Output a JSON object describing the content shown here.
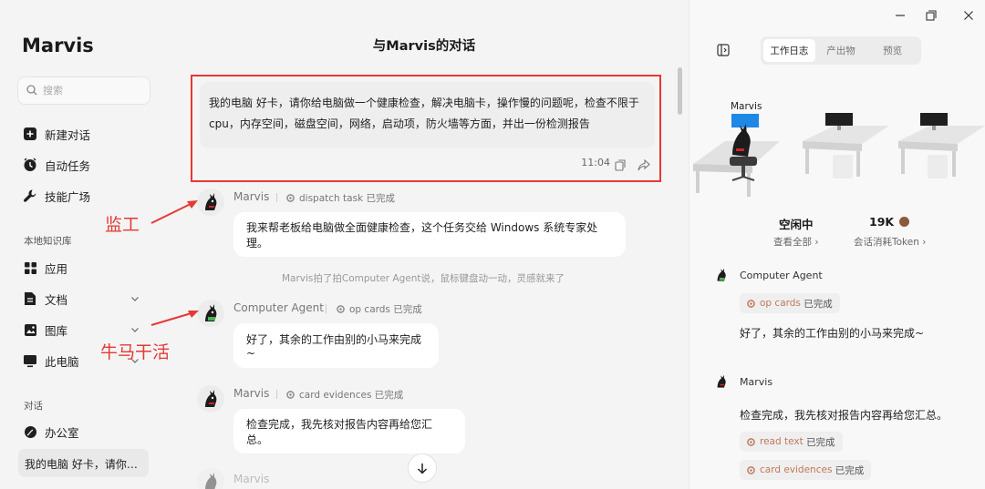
{
  "sidebar": {
    "brand": "Marvis",
    "search_placeholder": "搜索",
    "nav": [
      {
        "label": "新建对话",
        "icon": "plus-icon"
      },
      {
        "label": "自动任务",
        "icon": "clock-icon"
      },
      {
        "label": "技能广场",
        "icon": "wrench-icon"
      }
    ],
    "knowledge_label": "本地知识库",
    "knowledge": [
      {
        "label": "应用",
        "icon": "grid-icon"
      },
      {
        "label": "文档",
        "icon": "document-icon"
      },
      {
        "label": "图库",
        "icon": "image-icon"
      },
      {
        "label": "此电脑",
        "icon": "monitor-icon"
      }
    ],
    "conversations_label": "对话",
    "office_label": "办公室",
    "active_conversation": "我的电脑 好卡，请你…"
  },
  "chat": {
    "title": "与Marvis的对话",
    "user_message": "我的电脑 好卡，请你给电脑做一个健康检查，解决电脑卡，操作慢的问题呢，检查不限于cpu，内存空间，磁盘空间，网络，启动项，防火墙等方面，并出一份检测报告",
    "user_time": "11:04",
    "messages": [
      {
        "name": "Marvis",
        "task": "dispatch task",
        "status": "已完成",
        "text": "我来帮老板给电脑做全面健康检查，这个任务交给 Windows 系统专家处理。"
      },
      {
        "name": "Computer Agent",
        "task": "op cards",
        "status": "已完成",
        "text": "好了，其余的工作由别的小马来完成~"
      },
      {
        "name": "Marvis",
        "task": "card evidences",
        "status": "已完成",
        "text": "检查完成，我先核对报告内容再给您汇总。"
      },
      {
        "name": "Marvis"
      }
    ],
    "system_note": "Marvis拍了拍Computer Agent说，鼠标键盘动一动，灵感就来了"
  },
  "annotations": {
    "supervisor": "监工",
    "worker": "牛马干活"
  },
  "panel": {
    "tabs": [
      "工作日志",
      "产出物",
      "预览"
    ],
    "active_tab": 0,
    "scene_label": "Marvis",
    "status_value": "空闲中",
    "status_link": "查看全部",
    "token_value": "19K",
    "token_link": "会话消耗Token",
    "logs": [
      {
        "name": "Computer Agent",
        "tags": [
          {
            "task": "op cards",
            "status": "已完成"
          }
        ],
        "text": "好了，其余的工作由别的小马来完成~"
      },
      {
        "name": "Marvis",
        "text": "检查完成，我先核对报告内容再给您汇总。",
        "tags": [
          {
            "task": "read text",
            "status": "已完成"
          },
          {
            "task": "card evidences",
            "status": "已完成"
          }
        ]
      }
    ]
  },
  "colors": {
    "accent_red": "#e53935",
    "task_status": "#c0785a"
  }
}
